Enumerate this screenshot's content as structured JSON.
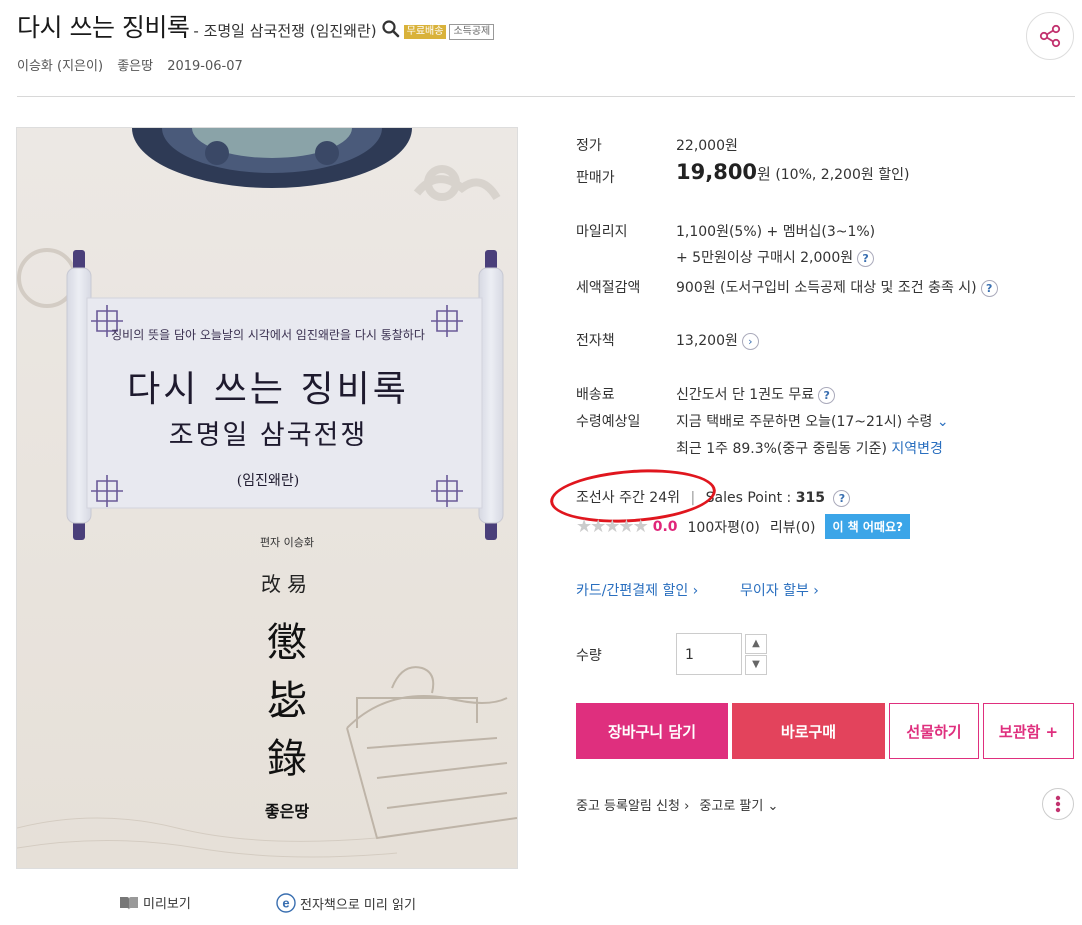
{
  "header": {
    "title": "다시 쓰는 징비록",
    "subtitle": "- 조명일 삼국전쟁 (임진왜란)",
    "badge_free": "무료배송",
    "badge_tax": "소득공제",
    "author": "이승화 (지은이)",
    "publisher": "좋은땅",
    "date": "2019-06-07"
  },
  "cover": {
    "tagline": "징비의 뜻을 담아 오늘날의 시각에서 임진왜란을 다시 통찰하다",
    "title": "다시 쓰는 징비록",
    "subtitle": "조명일 삼국전쟁",
    "paren": "(임진왜란)",
    "author": "편자 이승화",
    "hanja_small": "改易",
    "hanja_1": "懲",
    "hanja_2": "毖",
    "hanja_3": "錄",
    "publisher": "좋은땅"
  },
  "preview": {
    "preview_label": "미리보기",
    "ebook_label": "전자책으로 미리 읽기"
  },
  "pricing": {
    "list_price_label": "정가",
    "list_price": "22,000원",
    "sale_price_label": "판매가",
    "sale_price": "19,800",
    "sale_price_unit": "원",
    "discount": "(10%, 2,200원 할인)",
    "mileage_label": "마일리지",
    "mileage_1": "1,100원(5%) + 멤버십(3~1%)",
    "mileage_2": "+ 5만원이상 구매시 2,000원",
    "tax_label": "세액절감액",
    "tax_value": "900원 (도서구입비 소득공제 대상 및 조건 충족 시)",
    "ebook_label": "전자책",
    "ebook_price": "13,200원",
    "shipping_label": "배송료",
    "shipping_value": "신간도서 단 1권도 무료",
    "delivery_label": "수령예상일",
    "delivery_value": "지금 택배로 주문하면 오늘(17~21시) 수령",
    "delivery_rate": "최근 1주 89.3%(중구 중림동 기준)",
    "region_change": "지역변경"
  },
  "ranking": {
    "rank": "조선사 주간 24위",
    "separator": "|",
    "sales_point_label": "Sales Point :",
    "sales_point": "315"
  },
  "review": {
    "score": "0.0",
    "rating_count": "100자평(0)",
    "review_count": "리뷰(0)",
    "how_button": "이 책 어때요?"
  },
  "links": {
    "card_discount": "카드/간편결제 할인",
    "installment": "무이자 할부"
  },
  "quantity": {
    "label": "수량",
    "value": "1"
  },
  "buttons": {
    "cart": "장바구니 담기",
    "buy": "바로구매",
    "gift": "선물하기",
    "save": "보관함 +"
  },
  "used": {
    "register": "중고 등록알림 신청",
    "sell": "중고로 팔기"
  },
  "colors": {
    "accent_pink": "#df2f7e",
    "accent_red": "#e3435c",
    "link_blue": "#2a6fbf",
    "badge_gold": "#d9b23a",
    "annotation_red": "#e0161e"
  }
}
